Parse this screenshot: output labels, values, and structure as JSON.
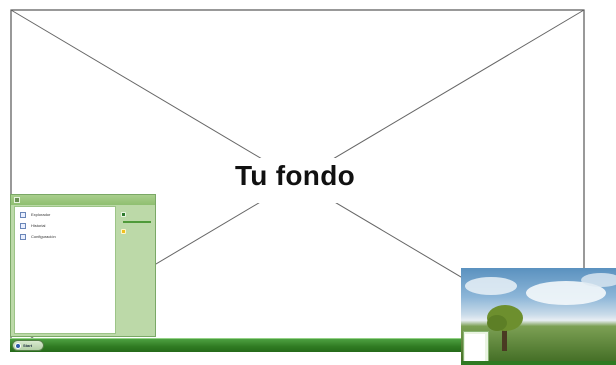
{
  "wallpaper": {
    "label": "Tu fondo"
  },
  "start_menu": {
    "user": "",
    "items": [
      {
        "label": "Explorador",
        "icon": "folder-icon"
      },
      {
        "label": "Historial",
        "icon": "history-icon"
      },
      {
        "label": "Configuración",
        "icon": "settings-icon"
      }
    ],
    "right_items": [
      {
        "label": "",
        "icon": "computer-icon",
        "color": "#2e7a2e"
      },
      {
        "label": "",
        "icon": "star-icon",
        "color": "#f0c020"
      }
    ]
  },
  "taskbar": {
    "start_label": "Start"
  },
  "colors": {
    "accent": "#3a8a2e",
    "menu_bg": "#bcd9a8"
  }
}
